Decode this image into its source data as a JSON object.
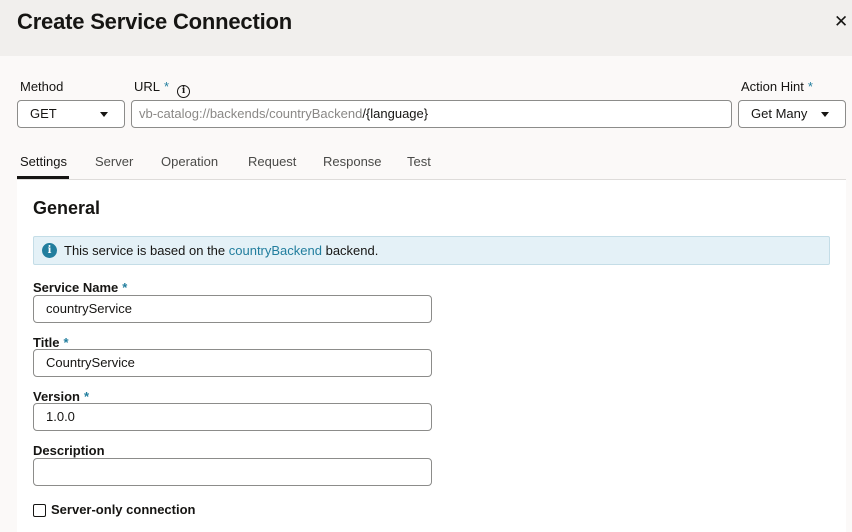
{
  "dialog": {
    "title": "Create Service Connection",
    "close_glyph": "✕"
  },
  "request_bar": {
    "method_label": "Method",
    "method_value": "GET",
    "url_label": "URL",
    "url_required": "*",
    "url_base": "vb-catalog://backends/countryBackend",
    "url_path": "/{language}",
    "action_hint_label": "Action Hint",
    "action_hint_required": "*",
    "action_hint_value": "Get Many"
  },
  "tabs": [
    {
      "label": "Settings",
      "active": true
    },
    {
      "label": "Server",
      "active": false
    },
    {
      "label": "Operation",
      "active": false
    },
    {
      "label": "Request",
      "active": false
    },
    {
      "label": "Response",
      "active": false
    },
    {
      "label": "Test",
      "active": false
    }
  ],
  "general": {
    "section_title": "General",
    "banner_prefix": "This service is based on the ",
    "banner_link": "countryBackend",
    "banner_suffix": " backend.",
    "fields": {
      "service_name": {
        "label": "Service Name",
        "required": "*",
        "value": "countryService"
      },
      "title": {
        "label": "Title",
        "required": "*",
        "value": "CountryService"
      },
      "version": {
        "label": "Version",
        "required": "*",
        "value": "1.0.0"
      },
      "description": {
        "label": "Description",
        "value": ""
      }
    },
    "server_only": {
      "label": "Server-only connection",
      "checked": false
    }
  },
  "colors": {
    "accent": "#227e9e",
    "header_bg": "#f1efed",
    "banner_bg": "#e4f1f7"
  }
}
